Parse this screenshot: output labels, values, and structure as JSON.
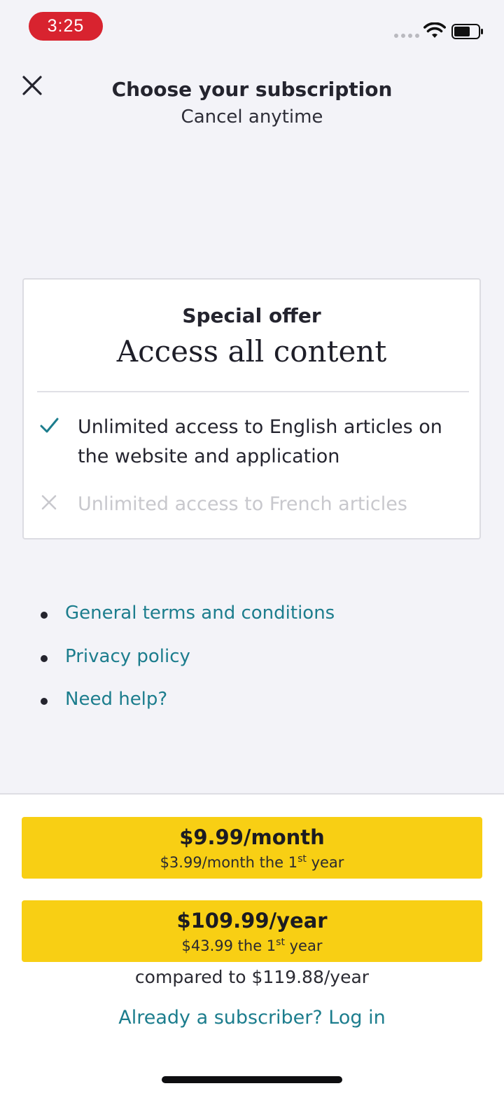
{
  "status_bar": {
    "time": "3:25"
  },
  "header": {
    "title": "Choose your subscription",
    "subtitle": "Cancel anytime",
    "close_icon": "close-icon"
  },
  "offer": {
    "eyebrow": "Special offer",
    "title": "Access all content",
    "features": [
      {
        "text": "Unlimited access to English articles on the website and application",
        "included": true,
        "icon": "check-icon",
        "icon_color": "#1c7d8d"
      },
      {
        "text": "Unlimited access to French articles",
        "included": false,
        "icon": "cross-icon",
        "icon_color": "#c8c8cd"
      }
    ]
  },
  "links": [
    {
      "label": "General terms and conditions"
    },
    {
      "label": "Privacy policy"
    },
    {
      "label": "Need help?"
    }
  ],
  "plans": {
    "monthly": {
      "price": "$9.99/month",
      "note_prefix": "$3.99/month the 1",
      "note_sup": "st",
      "note_suffix": " year"
    },
    "yearly": {
      "price": "$109.99/year",
      "note_prefix": "$43.99 the 1",
      "note_sup": "st",
      "note_suffix": " year"
    }
  },
  "compare_text": "compared to $119.88/year",
  "login_link": "Already a subscriber? Log in",
  "colors": {
    "accent": "#1c7d8d",
    "button": "#f8cf14",
    "time_pill": "#d8232f",
    "background": "#f3f3f8"
  }
}
